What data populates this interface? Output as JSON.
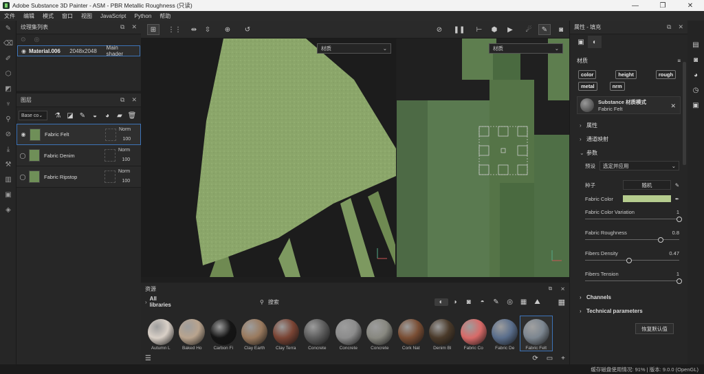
{
  "window": {
    "title": "Adobe Substance 3D Painter - ASM - PBR Metallic Roughness (只读)",
    "minimize": "—",
    "maximize": "❐",
    "close": "✕"
  },
  "menu": [
    "文件",
    "编辑",
    "模式",
    "窗口",
    "视图",
    "JavaScript",
    "Python",
    "帮助"
  ],
  "texture_set_list": {
    "title": "纹理集列表",
    "row": {
      "name": "Material.006",
      "resolution": "2048x2048",
      "shader": "Main shader"
    }
  },
  "layers": {
    "title": "图层",
    "channel_dropdown": "Base co",
    "items": [
      {
        "name": "Fabric Felt",
        "blend": "Norm",
        "opacity": "100"
      },
      {
        "name": "Fabric Denim",
        "blend": "Norm",
        "opacity": "100"
      },
      {
        "name": "Fabric Ripstop",
        "blend": "Norm",
        "opacity": "100"
      }
    ]
  },
  "viewport": {
    "left_select": "材质",
    "right_select": "材质"
  },
  "assets": {
    "title": "资源",
    "library": "All libraries",
    "search_placeholder": "搜索",
    "items": [
      {
        "label": "Autumn L",
        "color": "#d9d0c7"
      },
      {
        "label": "Baked Ho",
        "color": "#b9a48e"
      },
      {
        "label": "Carbon Fi",
        "color": "#151515"
      },
      {
        "label": "Clay Earth",
        "color": "#9a7a5e"
      },
      {
        "label": "Clay Terra",
        "color": "#7a4434"
      },
      {
        "label": "Concrete",
        "color": "#5c5c5c"
      },
      {
        "label": "Concrete",
        "color": "#8c8c8c"
      },
      {
        "label": "Concrete",
        "color": "#888880"
      },
      {
        "label": "Cork Nat",
        "color": "#7a4e34"
      },
      {
        "label": "Denim Bl",
        "color": "#4a3a2a"
      },
      {
        "label": "Fabric Co",
        "color": "#d86a68"
      },
      {
        "label": "Fabric De",
        "color": "#5a6e8c"
      },
      {
        "label": "Fabric Felt",
        "color": "#7c8690"
      }
    ]
  },
  "properties": {
    "title": "属性 - 填充",
    "material_label": "材质",
    "channels": [
      "color",
      "height",
      "rough",
      "metal",
      "nrm"
    ],
    "material_mode": {
      "title": "Substance 材质模式",
      "name": "Fabric Felt"
    },
    "sections": {
      "attributes": "属性",
      "uv_mapping": "通道映射",
      "parameters": "参数"
    },
    "preset_label": "预设",
    "preset_value": "选定并应用",
    "seed_label": "种子",
    "seed_value": "随机",
    "fabric_color_label": "Fabric Color",
    "fabric_color": "#b5cc8e",
    "sliders": [
      {
        "label": "Fabric Color Variation",
        "value": "1",
        "fraction": 1.0
      },
      {
        "label": "Fabric Roughness",
        "value": "0.8",
        "fraction": 0.8
      },
      {
        "label": "Fibers Density",
        "value": "0.47",
        "fraction": 0.47
      },
      {
        "label": "Fibers Tension",
        "value": "1",
        "fraction": 1.0
      }
    ],
    "channels_section": "Channels",
    "technical_section": "Technical parameters",
    "reset_button": "恢复默认值"
  },
  "status": "缓存磁盘使用情况: 91% | 版本: 9.0.0 (OpenGL)"
}
